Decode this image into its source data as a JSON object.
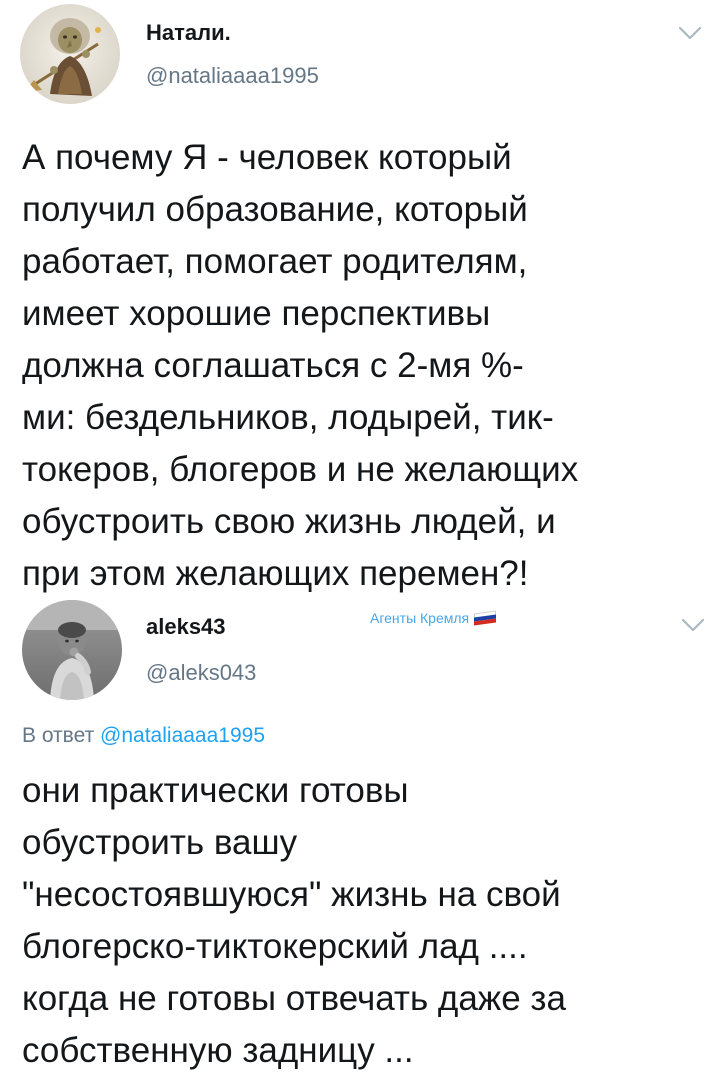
{
  "tweets": [
    {
      "display_name": "Натали.",
      "handle": "@nataliaaaa1995",
      "avatar_icon": "witch-avatar-icon",
      "text": "А почему Я - человек который\nполучил образование, который\nработает, помогает родителям,\nимеет хорошие перспективы\nдолжна соглашаться с 2-мя %-\nми: бездельников, лодырей, тик-\nтокеров, блогеров и не желающих\nобустроить свою жизнь людей, и\nпри этом желающих перемен?!"
    },
    {
      "display_name": "aleks43",
      "handle": "@aleks043",
      "avatar_icon": "child-photo-avatar-icon",
      "badge": "Агенты Кремля",
      "badge_icon": "russian-flag-icon",
      "reply_prefix": "В ответ",
      "reply_mention": "@nataliaaaa1995",
      "text": "они практически готовы\nобустроить вашу\n\"несостоявшуюся\" жизнь на свой\nблогерско-тиктокерский лад ....\nкогда не готовы отвечать даже за\nсобственную задницу ..."
    }
  ],
  "colors": {
    "text": "#14171a",
    "secondary": "#657786",
    "link": "#1da1f2",
    "badge": "#49a6e9"
  }
}
